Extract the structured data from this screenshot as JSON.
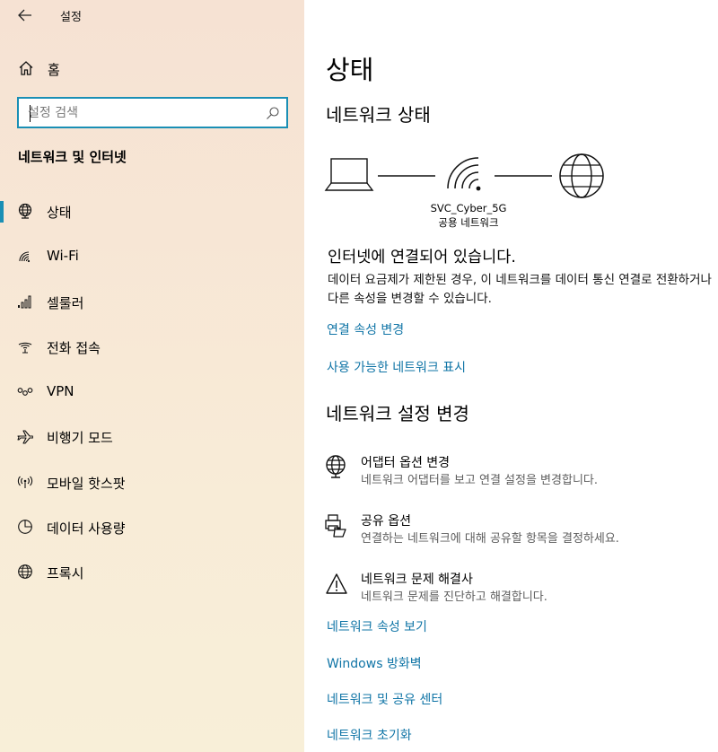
{
  "window": {
    "title": "설정"
  },
  "sidebar": {
    "home_label": "홈",
    "search_placeholder": "설정 검색",
    "section_title": "네트워크 및 인터넷",
    "items": [
      {
        "label": "상태",
        "icon": "globe-network-icon"
      },
      {
        "label": "Wi-Fi",
        "icon": "wifi-icon"
      },
      {
        "label": "셀룰러",
        "icon": "cellular-icon"
      },
      {
        "label": "전화 접속",
        "icon": "dialup-icon"
      },
      {
        "label": "VPN",
        "icon": "vpn-icon"
      },
      {
        "label": "비행기 모드",
        "icon": "airplane-icon"
      },
      {
        "label": "모바일 핫스팟",
        "icon": "hotspot-icon"
      },
      {
        "label": "데이터 사용량",
        "icon": "data-usage-icon"
      },
      {
        "label": "프록시",
        "icon": "globe-icon"
      }
    ],
    "selected_index": 0,
    "accent_color": "#1a8fb5"
  },
  "main": {
    "title": "상태",
    "network_status_heading": "네트워크 상태",
    "network_name": "SVC_Cyber_5G",
    "network_type": "공용 네트워크",
    "status_heading": "인터넷에 연결되어 있습니다.",
    "status_desc": "데이터 요금제가 제한된 경우, 이 네트워크를 데이터 통신 연결로 전환하거나 다른 속성을 변경할 수 있습니다.",
    "link_change_properties": "연결 속성 변경",
    "link_show_networks": "사용 가능한 네트워크 표시",
    "change_settings_heading": "네트워크 설정 변경",
    "settings": [
      {
        "title": "어댑터 옵션 변경",
        "desc": "네트워크 어댑터를 보고 연결 설정을 변경합니다.",
        "icon": "adapter-icon"
      },
      {
        "title": "공유 옵션",
        "desc": "연결하는 네트워크에 대해 공유할 항목을 결정하세요.",
        "icon": "sharing-icon"
      },
      {
        "title": "네트워크 문제 해결사",
        "desc": "네트워크 문제를 진단하고 해결합니다.",
        "icon": "warning-icon"
      }
    ],
    "links_bottom": [
      "네트워크 속성 보기",
      "Windows 방화벽",
      "네트워크 및 공유 센터",
      "네트워크 초기화"
    ],
    "link_color": "#0f74a6"
  }
}
